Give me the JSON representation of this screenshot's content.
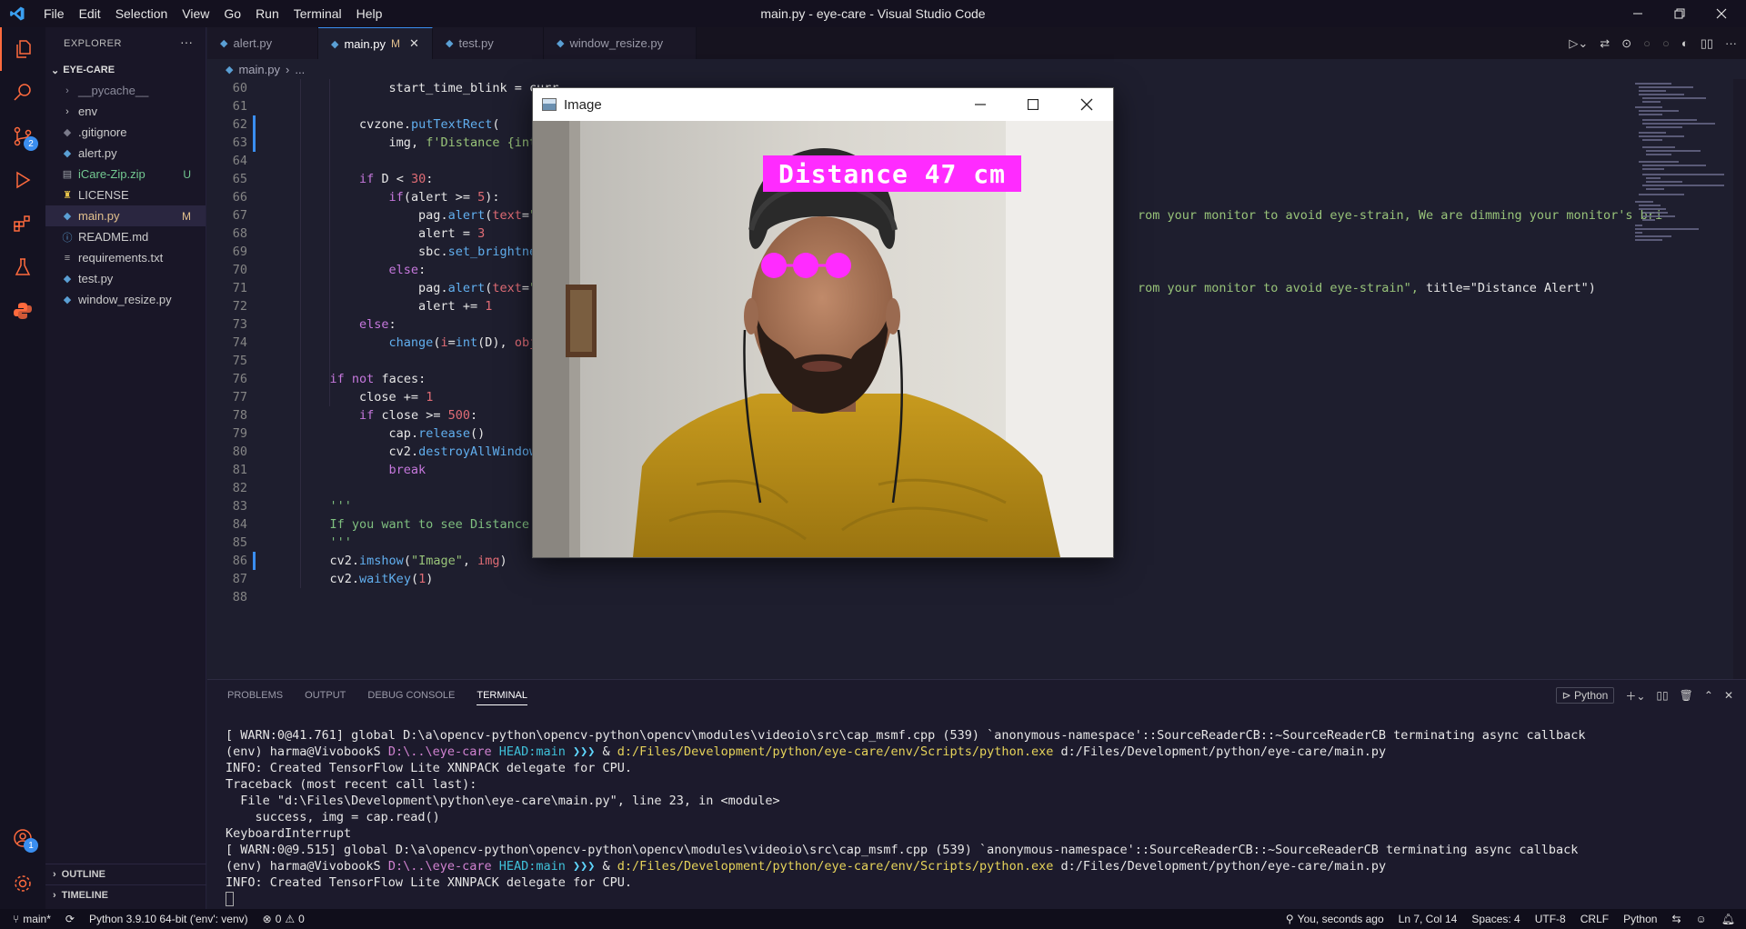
{
  "titlebar": {
    "menu": [
      "File",
      "Edit",
      "Selection",
      "View",
      "Go",
      "Run",
      "Terminal",
      "Help"
    ],
    "title": "main.py - eye-care - Visual Studio Code"
  },
  "activity": {
    "source_control_badge": "2",
    "accounts_badge": "1"
  },
  "sidebar": {
    "header": "EXPLORER",
    "folder": "EYE-CARE",
    "items": [
      {
        "label": "__pycache__",
        "status": ""
      },
      {
        "label": "env",
        "status": ""
      },
      {
        "label": ".gitignore",
        "status": ""
      },
      {
        "label": "alert.py",
        "status": ""
      },
      {
        "label": "iCare-Zip.zip",
        "status": "U"
      },
      {
        "label": "LICENSE",
        "status": ""
      },
      {
        "label": "main.py",
        "status": "M"
      },
      {
        "label": "README.md",
        "status": ""
      },
      {
        "label": "requirements.txt",
        "status": ""
      },
      {
        "label": "test.py",
        "status": ""
      },
      {
        "label": "window_resize.py",
        "status": ""
      }
    ],
    "outline": "OUTLINE",
    "timeline": "TIMELINE"
  },
  "tabs": [
    {
      "label": "alert.py"
    },
    {
      "label": "main.py",
      "status": "M"
    },
    {
      "label": "test.py"
    },
    {
      "label": "window_resize.py"
    }
  ],
  "breadcrumb": {
    "file": "main.py",
    "rest": "..."
  },
  "editor": {
    "line_numbers": [
      "60",
      "61",
      "62",
      "63",
      "64",
      "65",
      "66",
      "67",
      "68",
      "69",
      "70",
      "71",
      "72",
      "73",
      "74",
      "75",
      "76",
      "77",
      "78",
      "79",
      "80",
      "81",
      "82",
      "83",
      "84",
      "85",
      "86",
      "87",
      "88"
    ],
    "right_fragments": {
      "line67": "rom your monitor to avoid eye-strain, We are dimming your monitor's bri",
      "line71_a": "rom your monitor to avoid eye-strain\", ",
      "line71_b": "title=\"Distance Alert\")"
    }
  },
  "image_window": {
    "title": "Image",
    "distance_label": "Distance 47 cm"
  },
  "panel": {
    "tabs": [
      "PROBLEMS",
      "OUTPUT",
      "DEBUG CONSOLE",
      "TERMINAL"
    ],
    "shell": "Python",
    "terminal": {
      "warn1": "[ WARN:0@41.761] global D:\\a\\opencv-python\\opencv-python\\opencv\\modules\\videoio\\src\\cap_msmf.cpp (539) `anonymous-namespace'::SourceReaderCB::~SourceReaderCB terminating async callback",
      "prompt_env": "(env) harma@VivobookS ",
      "prompt_path": "D:\\..\\eye-care ",
      "prompt_branch": "HEAD:main ",
      "prompt_arrow": "❯❯❯ ",
      "prompt_amp": "& ",
      "prompt_exe": "d:/Files/Development/python/eye-care/env/Scripts/python.exe",
      "prompt_arg": " d:/Files/Development/python/eye-care/main.py",
      "info": "INFO: Created TensorFlow Lite XNNPACK delegate for CPU.",
      "tb1": "Traceback (most recent call last):",
      "tb2": "  File \"d:\\Files\\Development\\python\\eye-care\\main.py\", line 23, in <module>",
      "tb3": "    success, img = cap.read()",
      "tb4": "KeyboardInterrupt",
      "warn2": "[ WARN:0@9.515] global D:\\a\\opencv-python\\opencv-python\\opencv\\modules\\videoio\\src\\cap_msmf.cpp (539) `anonymous-namespace'::SourceReaderCB::~SourceReaderCB terminating async callback"
    }
  },
  "statusbar": {
    "branch": "main*",
    "interpreter": "Python 3.9.10 64-bit ('env': venv)",
    "errors": "0",
    "warnings": "0",
    "blame": "You, seconds ago",
    "cursor": "Ln 7, Col 14",
    "spaces": "Spaces: 4",
    "encoding": "UTF-8",
    "eol": "CRLF",
    "language": "Python"
  }
}
